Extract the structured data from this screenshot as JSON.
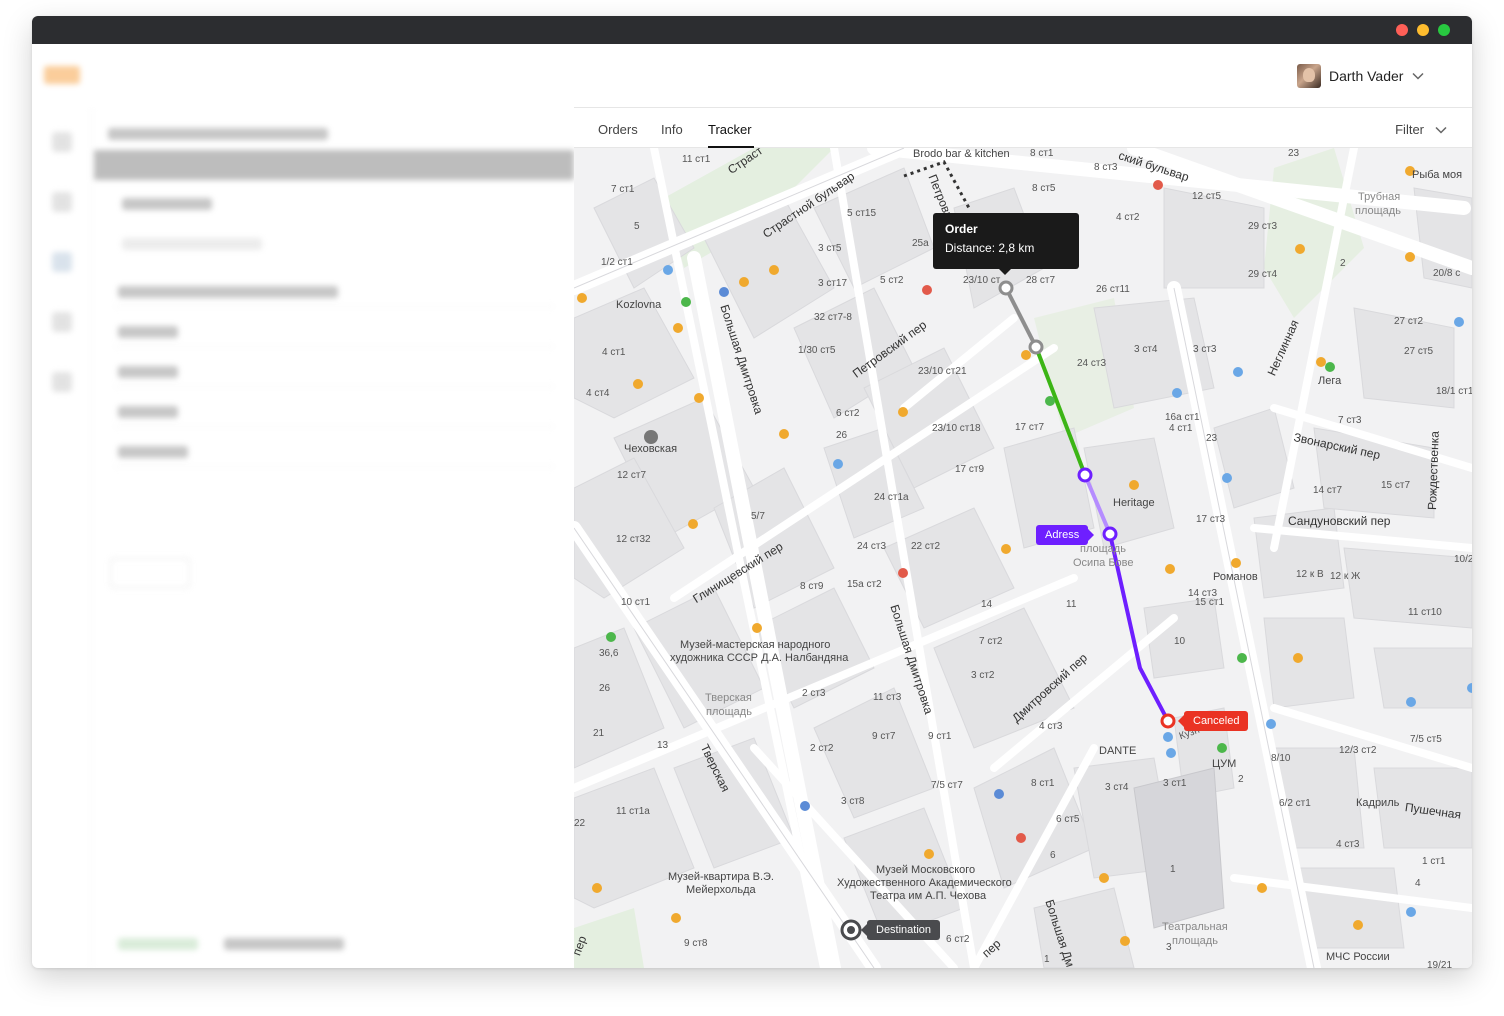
{
  "window": {
    "controls": [
      "close",
      "minimize",
      "maximize"
    ]
  },
  "header": {
    "user_name": "Darth Vader",
    "user_menu_icon": "chevron-down-icon"
  },
  "tabs": [
    {
      "label": "Orders",
      "active": false
    },
    {
      "label": "Info",
      "active": false
    },
    {
      "label": "Tracker",
      "active": true
    }
  ],
  "filter": {
    "label": "Filter",
    "icon": "chevron-down-icon"
  },
  "map": {
    "tooltip": {
      "title": "Order",
      "distance": "Distance: 2,8 km"
    },
    "markers": {
      "adress": "Adress",
      "canceled": "Canceled",
      "destination": "Destination"
    },
    "route_colors": {
      "completed": "#8e8e8e",
      "green": "#3cb515",
      "light": "#b58cff",
      "active": "#6e1fff",
      "canceled": "#ea3323",
      "destination": "#4a4b4e"
    },
    "streets": {
      "strastnoy": "Страстной бульвар",
      "petrovsky_bulvar": "ский бульвар",
      "petrovsky_per": "Петровский пер",
      "bolshaya_dmitrovka_1": "Большая Дмитровка",
      "bolshaya_dmitrovka_2": "Большая Дмитровка",
      "bolshaya_dmitrovka_3": "Большая Дм",
      "glinishchevsky": "Глинищевский пер",
      "dmitrovsky": "Дмитровский пер",
      "tverskaya": "Тверская",
      "neglinnaya": "Неглинная",
      "zvonarsky": "Звонарский пер",
      "sandunovsky": "Сандуновский пер",
      "rozhdestvenka": "Рождественка",
      "pushechnaya": "Пушечная",
      "strast_top": "Страст",
      "petrovka": "Петровка",
      "per_bottom": "пер",
      "per_left": "пер"
    },
    "places": {
      "brodo": "Brodo bar & kitchen",
      "kozlovna": "Kozlovna",
      "chekhovskaya": "Чеховская",
      "heritage": "Heritage",
      "ploshchad": "площадь",
      "osipa": "Осипа Бове",
      "romanov": "Романов",
      "tsum": "ЦУМ",
      "dante": "DANTE",
      "lega": "Лега",
      "ryba": "Рыба моя",
      "trubnaya": "Трубная",
      "trubnaya2": "площадь",
      "museum1a": "Музей-мастерская народного",
      "museum1b": "художника СССР Д.А. Налбандяна",
      "tverskaya_sq1": "Тверская",
      "tverskaya_sq2": "площадь",
      "museum2a": "Музей-квартира В.Э.",
      "museum2b": "Мейерхольда",
      "museum3a": "Музей Московского",
      "museum3b": "Художественного Академического",
      "museum3c": "Театра им А.П. Чехова",
      "teatr1": "Театральная",
      "teatr2": "площадь",
      "mchs": "МЧС России",
      "kadril": "Кадриль",
      "kuz": "Кузн",
      "t_ridge": "т"
    },
    "buildings": [
      "11 ст1",
      "7 ст1",
      "5",
      "1/2 ст1",
      "4 ст1",
      "4 ст4",
      "12 ст7",
      "12 ст32",
      "10 ст1",
      "36,6",
      "26",
      "21",
      "13",
      "22",
      "11 ст1а",
      "9 ст8",
      "8 ст1",
      "8 ст3",
      "8 ст5",
      "5 ст15",
      "3 ст5",
      "3 ст17",
      "5 ст2",
      "32 ст7-8",
      "1/30 ст5",
      "23/10 ст21",
      "25а",
      "23/10 ст",
      "28 ст7",
      "26 ст11",
      "4 ст2",
      "12 ст5",
      "29 ст3",
      "29 ст4",
      "23",
      "2",
      "27 ст2",
      "27 ст5",
      "20/8 с",
      "18/1 ст1",
      "16а ст1",
      "7 ст3",
      "3 ст4",
      "3 ст3",
      "24 ст3",
      "4 ст1",
      "23",
      "14 ст7",
      "15 ст7",
      "17 ст3",
      "12 к В",
      "12 к Ж",
      "10/2",
      "11 ст10",
      "14 ст3",
      "15 ст1",
      "10",
      "6 ст2",
      "26",
      "23/10 ст18",
      "17 ст7",
      "17 ст9",
      "24 ст1а",
      "24 ст3",
      "22 ст2",
      "15а ст2",
      "14",
      "11",
      "8 ст9",
      "5/7",
      "7 ст2",
      "3 ст2",
      "4 ст3",
      "2 ст3",
      "11 ст3",
      "9 ст7",
      "9 ст1",
      "2 ст2",
      "7/5 ст7",
      "3 ст8",
      "8 ст1",
      "3 ст4",
      "3 ст1",
      "6 ст5",
      "6",
      "2",
      "8/10",
      "12/3 ст2",
      "7/5 ст5",
      "6/2 ст1",
      "4 ст3",
      "4",
      "1 ст1",
      "1",
      "3",
      "1",
      "6 ст2",
      "19/21"
    ]
  }
}
